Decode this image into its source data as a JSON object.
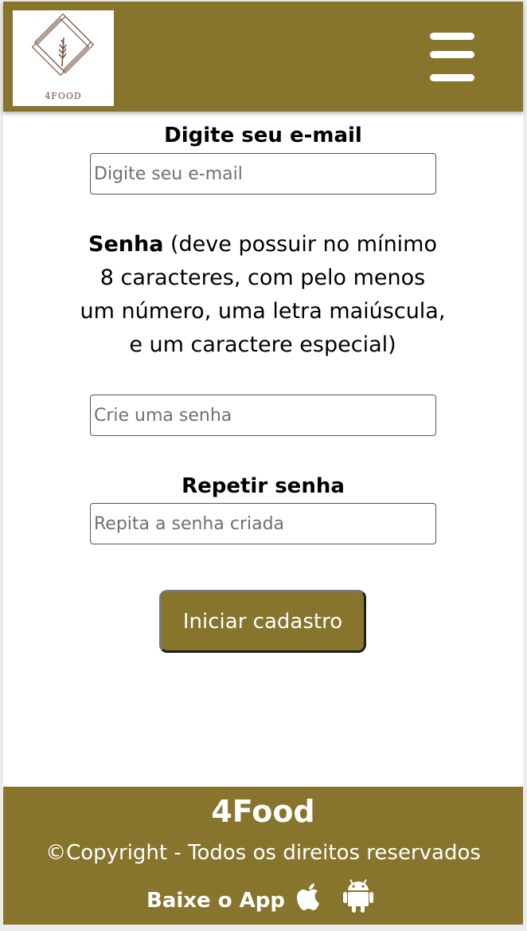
{
  "header": {
    "logo_text": "4FOOD",
    "menu_icon": "hamburger-menu-icon"
  },
  "form": {
    "email_label": "Digite seu e-mail",
    "email_placeholder": "Digite seu e-mail",
    "password_label_bold": "Senha",
    "password_label_rest": " (deve possuir no mínimo 8 caracteres, com pelo menos um número, uma letra maiúscula, e um caractere especial)",
    "password_placeholder": "Crie uma senha",
    "repeat_label": "Repetir senha",
    "repeat_placeholder": "Repita a senha criada",
    "submit_label": "Iniciar cadastro"
  },
  "footer": {
    "brand": "4Food",
    "copyright": "©Copyright - Todos os direitos reservados",
    "app_label": "Baixe o App",
    "icons": [
      "apple-icon",
      "android-icon"
    ]
  },
  "colors": {
    "brand": "#87742d",
    "background": "#ffffff",
    "text": "#000000"
  }
}
